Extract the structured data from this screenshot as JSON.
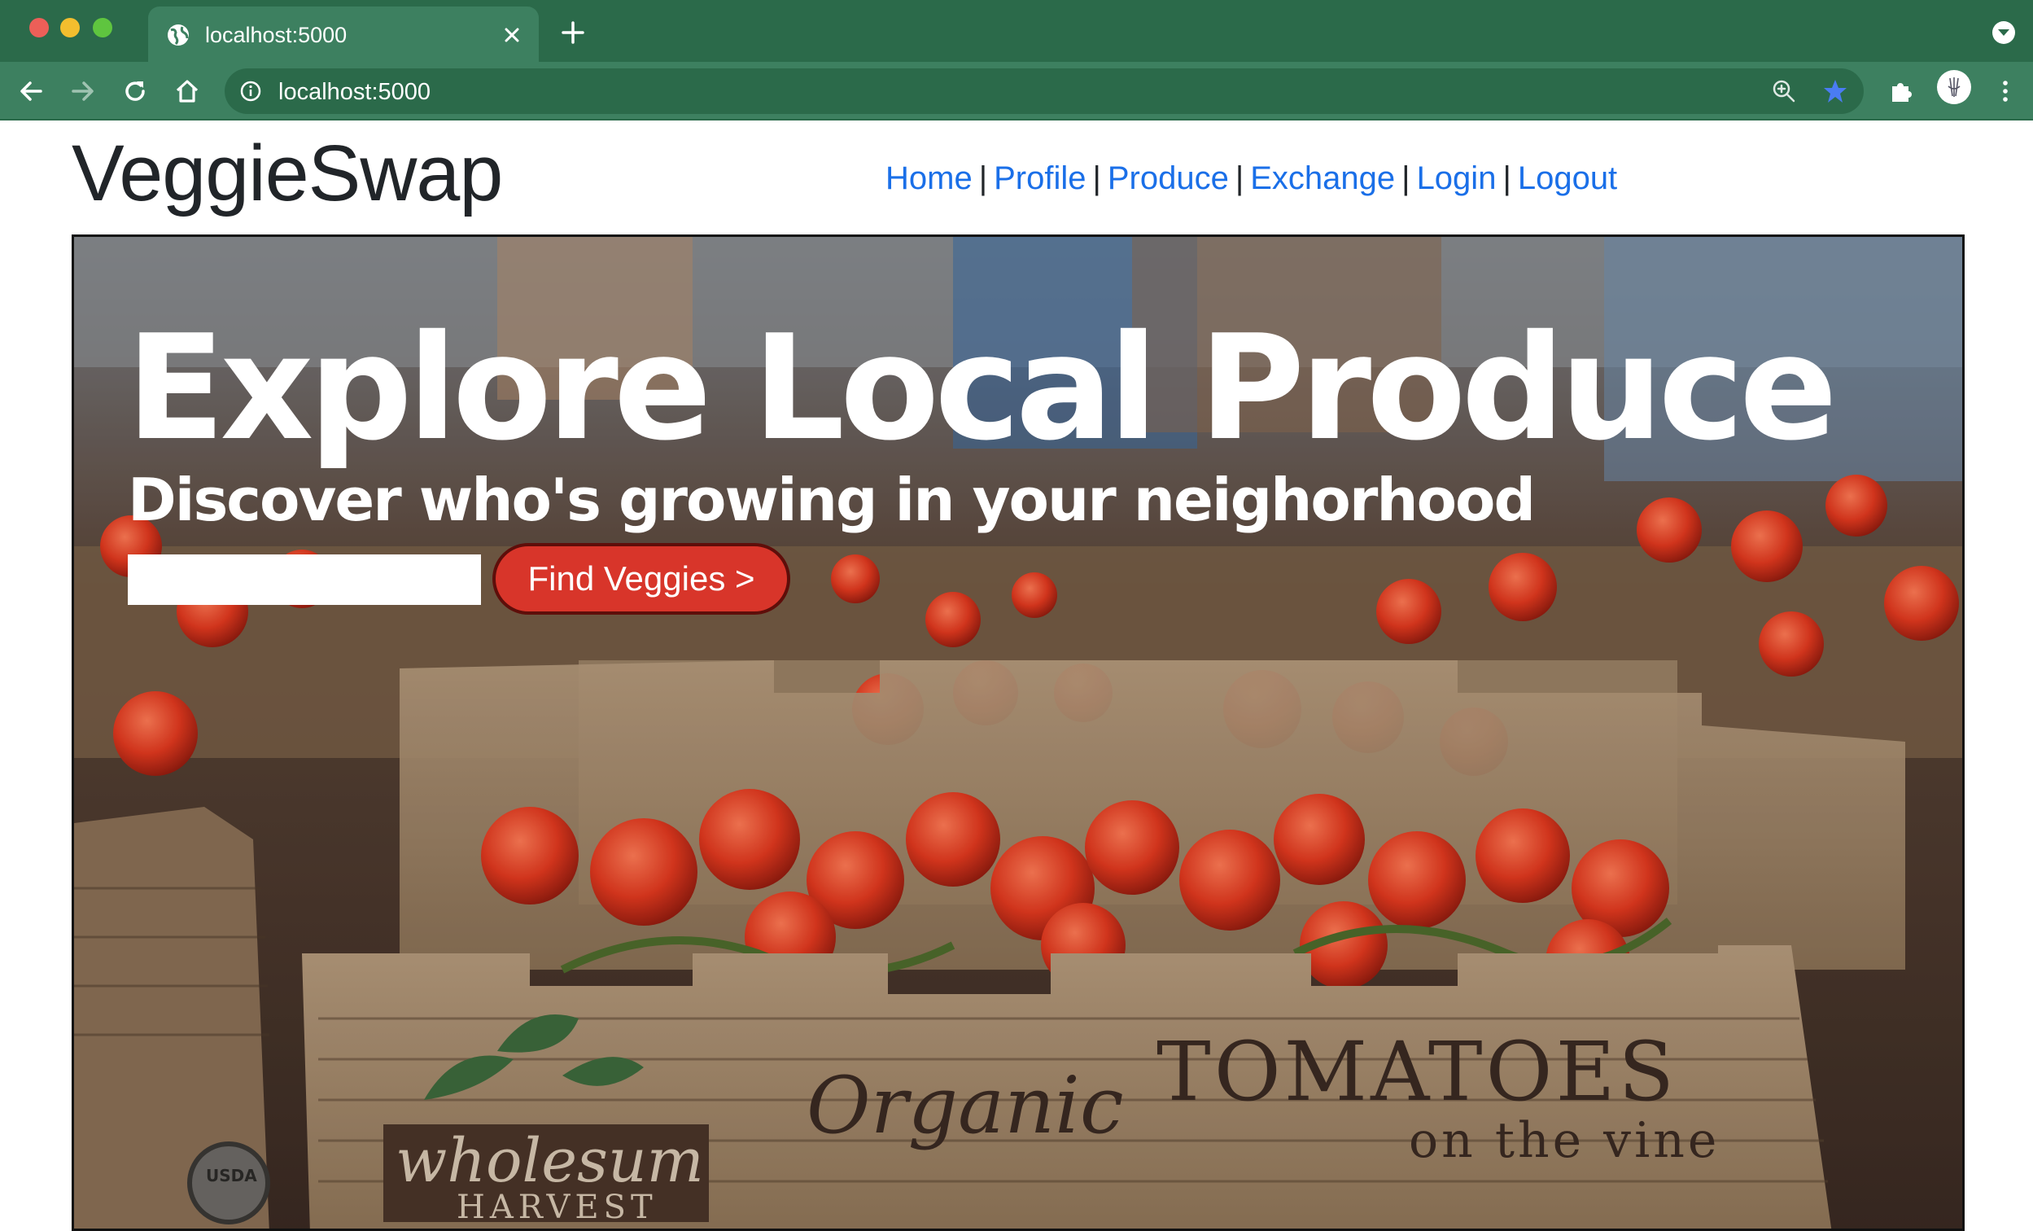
{
  "browser": {
    "tab_title": "localhost:5000",
    "url": "localhost:5000",
    "colors": {
      "chrome_dark": "#2b6a4a",
      "chrome_light": "#3d8060",
      "star": "#4a7cf3"
    }
  },
  "site": {
    "brand": "VeggieSwap",
    "nav": [
      {
        "label": "Home"
      },
      {
        "label": "Profile"
      },
      {
        "label": "Produce"
      },
      {
        "label": "Exchange"
      },
      {
        "label": "Login"
      },
      {
        "label": "Logout"
      }
    ],
    "nav_separator": "|",
    "colors": {
      "link": "#1a6fe8",
      "text": "#212529",
      "button": "#d8352a"
    }
  },
  "hero": {
    "title": "Explore Local Produce",
    "subtitle": "Discover who's growing in your neighorhood",
    "search_value": "",
    "button_label": "Find Veggies >",
    "photo_text": {
      "brand_line1": "wholesum",
      "brand_line2": "HARVEST",
      "product_script": "Organic",
      "product_name": "TOMATOES",
      "product_sub": "on the vine",
      "seal": "USDA"
    }
  }
}
